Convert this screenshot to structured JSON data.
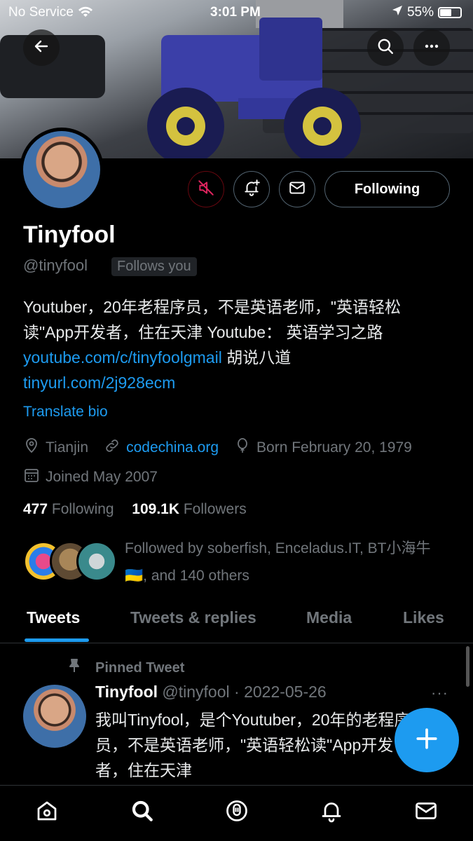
{
  "status_bar": {
    "carrier": "No Service",
    "time": "3:01 PM",
    "battery": "55%"
  },
  "profile": {
    "name": "Tinyfool",
    "handle": "@tinyfool",
    "follows_you": "Follows you",
    "follow_button": "Following",
    "bio_part1": "Youtuber，20年老程序员，不是英语老师，\"英语轻松读\"App开发者，住在天津 Youtube： 英语学习之路 ",
    "bio_link1": "youtube.com/c/tinyfoolgmail",
    "bio_part2": " 胡说八道 ",
    "bio_link2": "tinyurl.com/2j928ecm",
    "translate_bio": "Translate bio",
    "location": "Tianjin",
    "website": "codechina.org",
    "birthday": "Born February 20, 1979",
    "joined": "Joined May 2007",
    "following_count": "477",
    "following_label": "Following",
    "followers_count": "109.1K",
    "followers_label": "Followers",
    "followed_by": "Followed by soberfish, Enceladus.IT, BT小海牛 🇺🇦, and 140 others"
  },
  "tabs": [
    {
      "label": "Tweets",
      "active": true
    },
    {
      "label": "Tweets & replies",
      "active": false
    },
    {
      "label": "Media",
      "active": false
    },
    {
      "label": "Likes",
      "active": false
    }
  ],
  "pinned_tweet": {
    "pinned_label": "Pinned Tweet",
    "author": "Tinyfool",
    "handle_date": "@tinyfool · 2022-05-26",
    "more": "···",
    "text": "我叫Tinyfool，是个Youtuber，20年的老程序员，不是英语老师，\"英语轻松读\"App开发者，住在天津"
  },
  "colors": {
    "accent": "#1d9bf0",
    "muted_red": "#e0245e",
    "secondary_text": "#71767b"
  },
  "icons": {
    "back": "arrow-left-icon",
    "search": "search-icon",
    "more": "more-horizontal-icon",
    "mute": "mute-icon",
    "notify": "bell-plus-icon",
    "message": "mail-icon",
    "compose": "plus-icon"
  }
}
